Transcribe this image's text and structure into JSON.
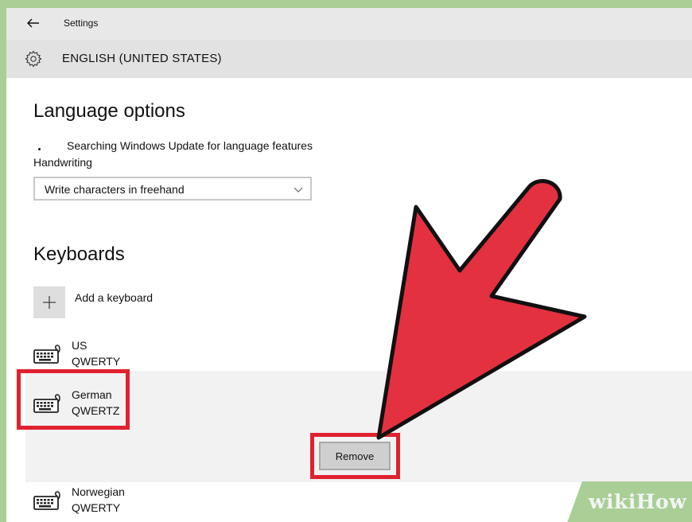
{
  "titlebar": {
    "title": "Settings"
  },
  "header": {
    "title": "ENGLISH (UNITED STATES)"
  },
  "language_options": {
    "heading": "Language options",
    "status": "Searching Windows Update for language features",
    "handwriting_label": "Handwriting",
    "handwriting_value": "Write characters in freehand"
  },
  "keyboards": {
    "heading": "Keyboards",
    "add_label": "Add a keyboard",
    "items": [
      {
        "name": "US",
        "layout": "QWERTY"
      },
      {
        "name": "German",
        "layout": "QWERTZ"
      },
      {
        "name": "Norwegian",
        "layout": "QWERTY"
      }
    ],
    "remove_label": "Remove"
  },
  "watermark": "wikiHow",
  "colors": {
    "highlight": "#e0222f",
    "arrow_fill": "#e33140",
    "background_frame": "#a9cf96"
  },
  "icons": {
    "back": "back-arrow-icon",
    "settings": "gear-icon",
    "dropdown": "chevron-down-icon",
    "add": "plus-icon",
    "keyboard": "keyboard-icon"
  }
}
